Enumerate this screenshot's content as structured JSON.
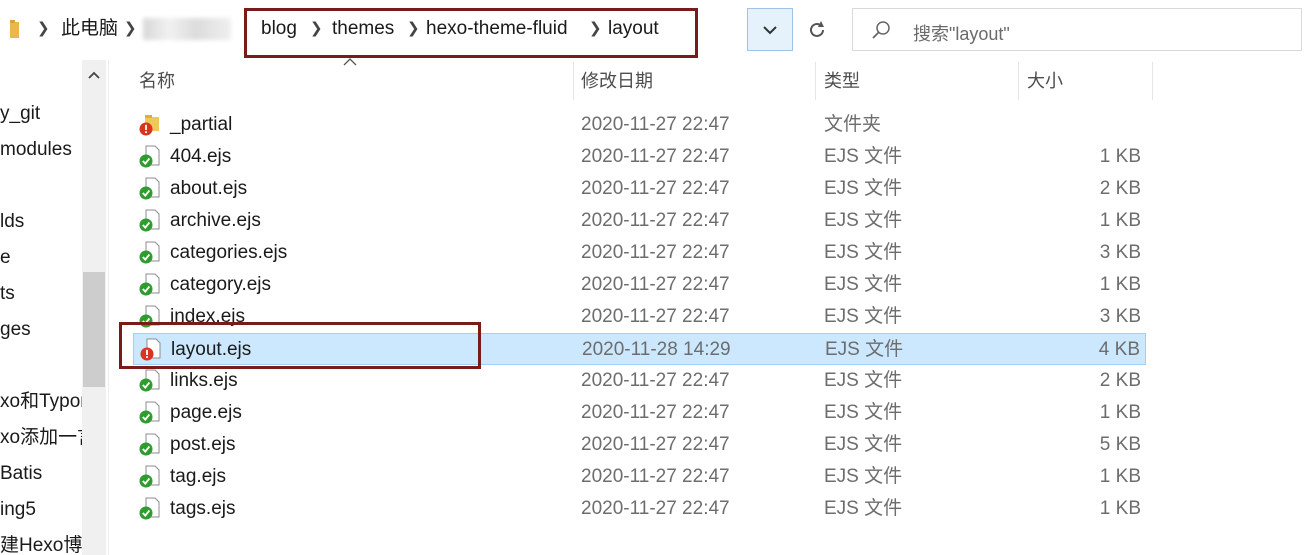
{
  "address_bar": {
    "root_label": "此电脑",
    "crumbs": [
      "blog",
      "themes",
      "hexo-theme-fluid",
      "layout"
    ]
  },
  "search": {
    "placeholder": "搜索\"layout\""
  },
  "nav": {
    "items": [
      "y_git",
      "modules",
      "",
      "lds",
      "e",
      "ts",
      "ges",
      "",
      "xo和Typor",
      "xo添加一言",
      "Batis",
      "ing5",
      "建Hexo博客"
    ]
  },
  "columns": {
    "name": "名称",
    "date": "修改日期",
    "type": "类型",
    "size": "大小"
  },
  "colors": {
    "selection": "#cce8ff",
    "annotation": "#7a1b1b",
    "status_ok": "#2e9d2e",
    "status_modified": "#d9341f"
  },
  "files": [
    {
      "name": "_partial",
      "date": "2020-11-27 22:47",
      "type": "文件夹",
      "size": "",
      "kind": "folder",
      "status": "modified",
      "selected": false
    },
    {
      "name": "404.ejs",
      "date": "2020-11-27 22:47",
      "type": "EJS 文件",
      "size": "1 KB",
      "kind": "file",
      "status": "ok",
      "selected": false
    },
    {
      "name": "about.ejs",
      "date": "2020-11-27 22:47",
      "type": "EJS 文件",
      "size": "2 KB",
      "kind": "file",
      "status": "ok",
      "selected": false
    },
    {
      "name": "archive.ejs",
      "date": "2020-11-27 22:47",
      "type": "EJS 文件",
      "size": "1 KB",
      "kind": "file",
      "status": "ok",
      "selected": false
    },
    {
      "name": "categories.ejs",
      "date": "2020-11-27 22:47",
      "type": "EJS 文件",
      "size": "3 KB",
      "kind": "file",
      "status": "ok",
      "selected": false
    },
    {
      "name": "category.ejs",
      "date": "2020-11-27 22:47",
      "type": "EJS 文件",
      "size": "1 KB",
      "kind": "file",
      "status": "ok",
      "selected": false
    },
    {
      "name": "index.ejs",
      "date": "2020-11-27 22:47",
      "type": "EJS 文件",
      "size": "3 KB",
      "kind": "file",
      "status": "ok",
      "selected": false
    },
    {
      "name": "layout.ejs",
      "date": "2020-11-28 14:29",
      "type": "EJS 文件",
      "size": "4 KB",
      "kind": "file",
      "status": "modified",
      "selected": true
    },
    {
      "name": "links.ejs",
      "date": "2020-11-27 22:47",
      "type": "EJS 文件",
      "size": "2 KB",
      "kind": "file",
      "status": "ok",
      "selected": false
    },
    {
      "name": "page.ejs",
      "date": "2020-11-27 22:47",
      "type": "EJS 文件",
      "size": "1 KB",
      "kind": "file",
      "status": "ok",
      "selected": false
    },
    {
      "name": "post.ejs",
      "date": "2020-11-27 22:47",
      "type": "EJS 文件",
      "size": "5 KB",
      "kind": "file",
      "status": "ok",
      "selected": false
    },
    {
      "name": "tag.ejs",
      "date": "2020-11-27 22:47",
      "type": "EJS 文件",
      "size": "1 KB",
      "kind": "file",
      "status": "ok",
      "selected": false
    },
    {
      "name": "tags.ejs",
      "date": "2020-11-27 22:47",
      "type": "EJS 文件",
      "size": "1 KB",
      "kind": "file",
      "status": "ok",
      "selected": false
    }
  ]
}
